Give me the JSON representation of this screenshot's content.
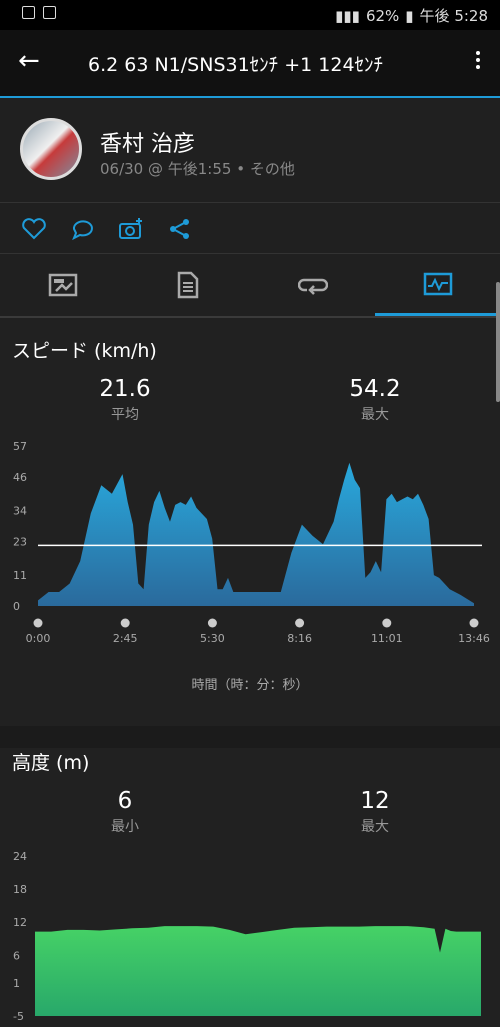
{
  "status": {
    "battery": "62%",
    "time": "午後 5:28"
  },
  "appbar": {
    "title": "6.2  63  N1/SNS31ｾﾝﾁ   +1  124ｾﾝﾁ"
  },
  "profile": {
    "name": "香村 治彦",
    "meta": "06/30 @ 午後1:55 • その他"
  },
  "icons": {
    "actions": [
      "heart-icon",
      "comment-icon",
      "camera-add-icon",
      "share-icon"
    ],
    "tabs": [
      "overview-icon",
      "details-icon",
      "laps-icon",
      "charts-icon"
    ]
  },
  "colors": {
    "accent": "#1e9bd8",
    "speed_fill_top": "#29a9dd",
    "speed_fill_bottom": "#2a6a9c",
    "elev_fill_top": "#46d266",
    "elev_fill_bottom": "#28a86a"
  },
  "speed": {
    "title": "スピード (km/h)",
    "avg_value": "21.6",
    "avg_label": "平均",
    "max_value": "54.2",
    "max_label": "最大",
    "xlabel": "時間（時：分：秒）"
  },
  "elevation": {
    "title": "高度 (m)",
    "min_value": "6",
    "min_label": "最小",
    "max_value": "12",
    "max_label": "最大"
  },
  "chart_data": [
    {
      "type": "area",
      "title": "スピード (km/h)",
      "xlabel": "時間（時：分：秒）",
      "ylabel": "",
      "y_ticks": [
        "0",
        "11",
        "23",
        "34",
        "46",
        "57"
      ],
      "x_ticks": [
        "0:00",
        "2:45",
        "5:30",
        "8:16",
        "11:01",
        "13:46"
      ],
      "ylim": [
        0,
        57
      ],
      "xlim": [
        0,
        826
      ],
      "reference_line": 21.6,
      "x_unit": "seconds",
      "x": [
        0,
        20,
        40,
        60,
        80,
        100,
        120,
        140,
        160,
        170,
        180,
        190,
        200,
        210,
        220,
        230,
        240,
        250,
        260,
        270,
        280,
        290,
        300,
        310,
        320,
        330,
        340,
        350,
        360,
        370,
        380,
        390,
        400,
        420,
        440,
        460,
        480,
        500,
        520,
        540,
        560,
        570,
        580,
        590,
        600,
        610,
        620,
        630,
        640,
        650,
        660,
        670,
        680,
        690,
        700,
        710,
        720,
        730,
        740,
        750,
        760,
        770,
        780,
        800,
        826
      ],
      "y": [
        2,
        5,
        5,
        8,
        16,
        33,
        43,
        40,
        47,
        37,
        29,
        8,
        6,
        29,
        37,
        41,
        35,
        30,
        36,
        37,
        36,
        39,
        35,
        33,
        31,
        24,
        6,
        6,
        10,
        5,
        5,
        5,
        5,
        5,
        5,
        5,
        19,
        29,
        25,
        22,
        30,
        38,
        45,
        51,
        45,
        42,
        10,
        12,
        16,
        12,
        38,
        40,
        37,
        38,
        39,
        38,
        40,
        36,
        31,
        11,
        10,
        8,
        6,
        4,
        1
      ]
    },
    {
      "type": "area",
      "title": "高度 (m)",
      "xlabel": "",
      "ylabel": "",
      "y_ticks": [
        "-5",
        "1",
        "6",
        "12",
        "18",
        "24"
      ],
      "ylim": [
        -5,
        24
      ],
      "xlim": [
        0,
        826
      ],
      "x": [
        0,
        30,
        60,
        90,
        120,
        150,
        180,
        210,
        240,
        270,
        300,
        330,
        360,
        390,
        420,
        450,
        480,
        510,
        540,
        570,
        600,
        630,
        660,
        690,
        720,
        740,
        750,
        760,
        770,
        780,
        800,
        826
      ],
      "y": [
        10.3,
        10.3,
        10.6,
        10.6,
        10.5,
        10.7,
        10.9,
        11,
        11.3,
        11.3,
        11.3,
        11.2,
        10.6,
        9.8,
        10.2,
        10.6,
        11,
        11.1,
        11.2,
        11.2,
        11.2,
        11.3,
        11.3,
        11.3,
        11.1,
        10.8,
        6.5,
        10.8,
        10.4,
        10.3,
        10.3,
        10.3
      ]
    }
  ]
}
